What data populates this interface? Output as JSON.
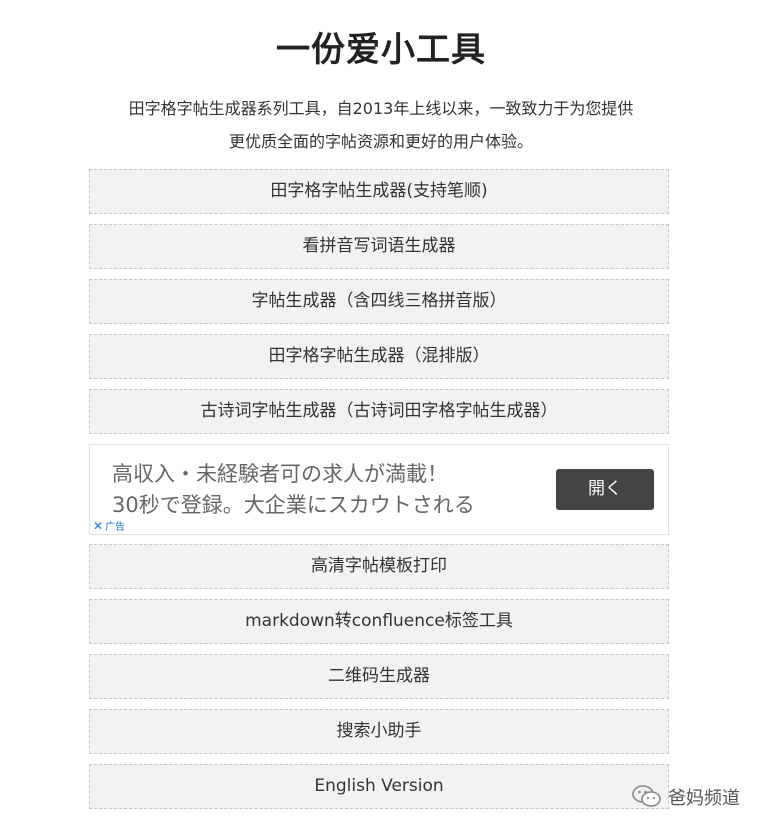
{
  "page": {
    "title": "一份爱小工具",
    "intro_line1": "田字格字帖生成器系列工具，自2013年上线以来，一致致力于为您提供",
    "intro_line2": "更优质全面的字帖资源和更好的用户体验。"
  },
  "tools": [
    {
      "label": "田字格字帖生成器(支持笔顺)"
    },
    {
      "label": "看拼音写词语生成器"
    },
    {
      "label": "字帖生成器（含四线三格拼音版）"
    },
    {
      "label": "田字格字帖生成器（混排版）"
    },
    {
      "label": "古诗词字帖生成器（古诗词田字格字帖生成器）"
    },
    {
      "label": "高清字帖模板打印"
    },
    {
      "label": "markdown转confluence标签工具"
    },
    {
      "label": "二维码生成器"
    },
    {
      "label": "搜索小助手"
    },
    {
      "label": "English Version"
    }
  ],
  "ad": {
    "line1": "高収入・未経験者可の求人が満載！",
    "line2": "30秒で登録。大企業にスカウトされる",
    "button_label": "開く",
    "close_glyph": "✕",
    "tag_label": "广告"
  },
  "watermark": {
    "text": "爸妈频道",
    "icon": "wechat-icon"
  }
}
